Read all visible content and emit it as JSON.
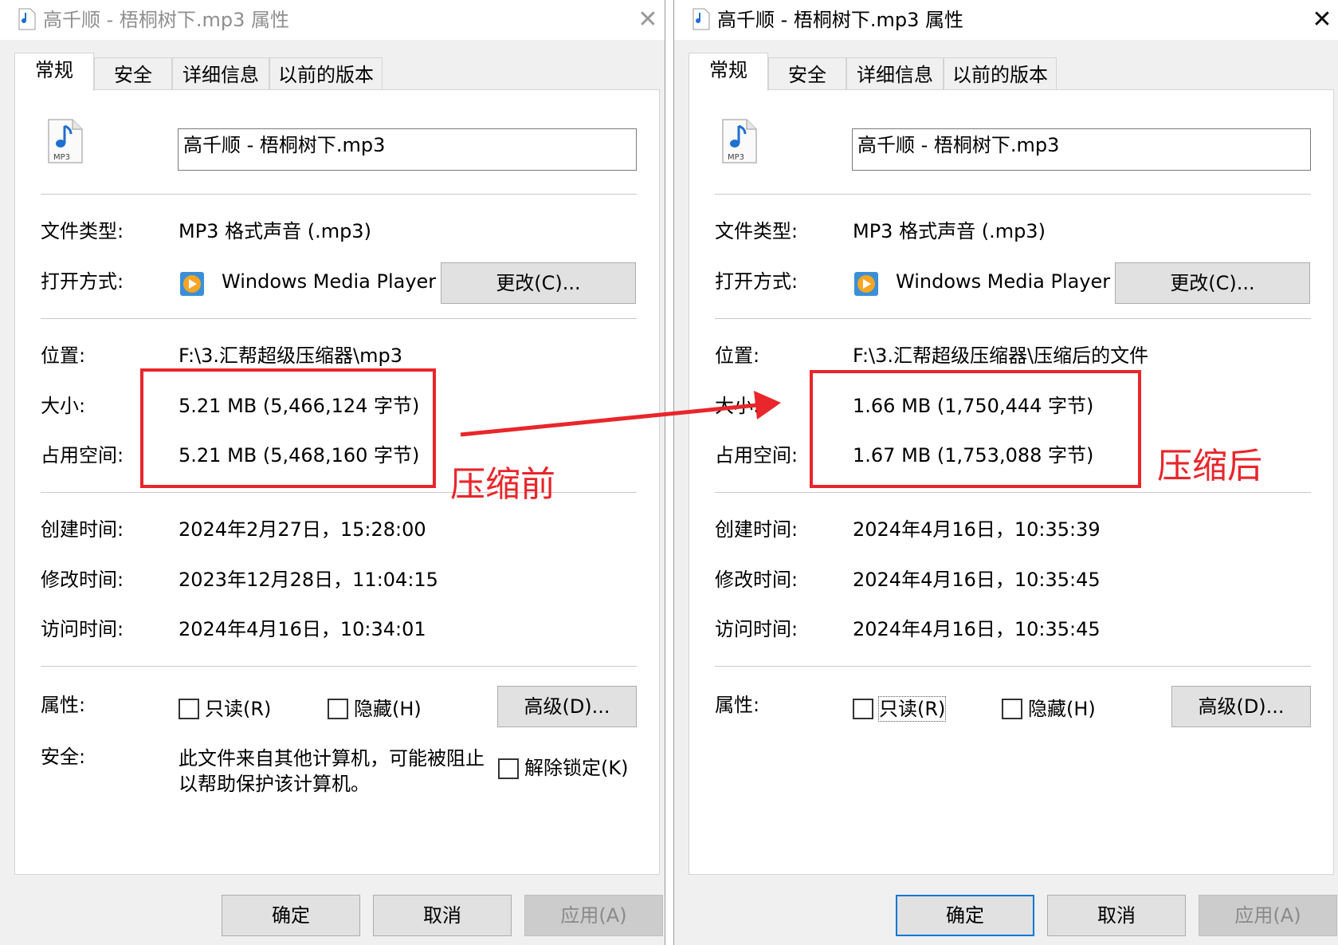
{
  "left_window": {
    "title": "高千顺 - 梧桐树下.mp3 属性",
    "close_glyph": "✕",
    "tabs": [
      "常规",
      "安全",
      "详细信息",
      "以前的版本"
    ],
    "active_tab": "常规",
    "file_icon_label": "MP3",
    "file_name": "高千顺 - 梧桐树下.mp3",
    "labels": {
      "file_type": "文件类型:",
      "open_with": "打开方式:",
      "location": "位置:",
      "size": "大小:",
      "size_on_disk": "占用空间:",
      "created": "创建时间:",
      "modified": "修改时间:",
      "accessed": "访问时间:",
      "attributes": "属性:",
      "security": "安全:"
    },
    "file_type": "MP3 格式声音 (.mp3)",
    "open_with_app": "Windows Media Player",
    "change_button": "更改(C)...",
    "location": "F:\\3.汇帮超级压缩器\\mp3",
    "size": "5.21 MB (5,466,124 字节)",
    "size_on_disk": "5.21 MB (5,468,160 字节)",
    "created": "2024年2月27日，15:28:00",
    "modified": "2023年12月28日，11:04:15",
    "accessed": "2024年4月16日，10:34:01",
    "readonly_label": "只读(R)",
    "hidden_label": "隐藏(H)",
    "advanced_button": "高级(D)...",
    "security_text": "此文件来自其他计算机，可能被阻止以帮助保护该计算机。",
    "unblock_label": "解除锁定(K)",
    "ok_button": "确定",
    "cancel_button": "取消",
    "apply_button": "应用(A)"
  },
  "right_window": {
    "title": "高千顺 - 梧桐树下.mp3 属性",
    "close_glyph": "✕",
    "tabs": [
      "常规",
      "安全",
      "详细信息",
      "以前的版本"
    ],
    "active_tab": "常规",
    "file_icon_label": "MP3",
    "file_name": "高千顺 - 梧桐树下.mp3",
    "labels": {
      "file_type": "文件类型:",
      "open_with": "打开方式:",
      "location": "位置:",
      "size": "大小:",
      "size_on_disk": "占用空间:",
      "created": "创建时间:",
      "modified": "修改时间:",
      "accessed": "访问时间:",
      "attributes": "属性:"
    },
    "file_type": "MP3 格式声音 (.mp3)",
    "open_with_app": "Windows Media Player",
    "change_button": "更改(C)...",
    "location": "F:\\3.汇帮超级压缩器\\压缩后的文件",
    "size": "1.66 MB (1,750,444 字节)",
    "size_on_disk": "1.67 MB (1,753,088 字节)",
    "created": "2024年4月16日，10:35:39",
    "modified": "2024年4月16日，10:35:45",
    "accessed": "2024年4月16日，10:35:45",
    "readonly_label": "只读(R)",
    "hidden_label": "隐藏(H)",
    "advanced_button": "高级(D)...",
    "ok_button": "确定",
    "cancel_button": "取消",
    "apply_button": "应用(A)"
  },
  "annotations": {
    "before_label": "压缩前",
    "after_label": "压缩后",
    "color": "#e8262b"
  }
}
